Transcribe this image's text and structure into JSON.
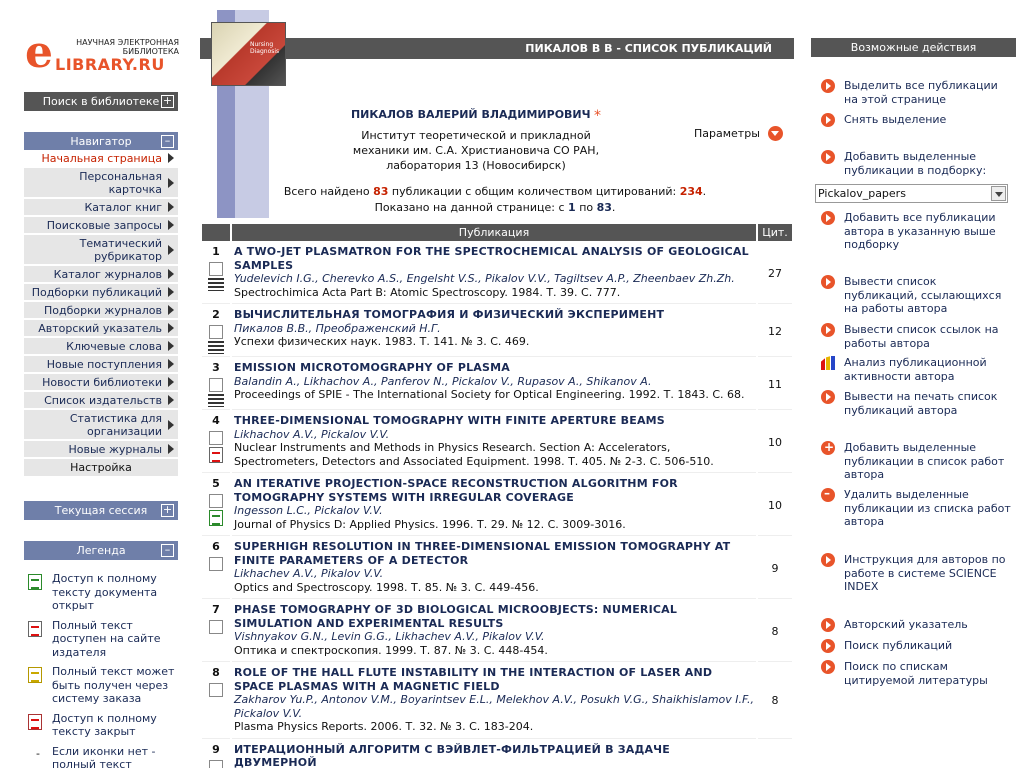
{
  "logo": {
    "top": "НАУЧНАЯ ЭЛЕКТРОННАЯ БИБЛИОТЕКА",
    "main": "LIBRARY.RU",
    "letter": "e"
  },
  "search": {
    "label": "Поиск в библиотеке",
    "toggle": "+"
  },
  "navigator": {
    "label": "Навигатор",
    "toggle": "–",
    "items": [
      "Начальная страница",
      "Персональная карточка",
      "Каталог книг",
      "Поисковые запросы",
      "Тематический рубрикатор",
      "Каталог журналов",
      "Подборки публикаций",
      "Подборки журналов",
      "Авторский указатель",
      "Ключевые слова",
      "Новые поступления",
      "Новости библиотеки",
      "Список издательств",
      "Статистика для организации",
      "Новые журналы",
      "Настройка"
    ]
  },
  "session": {
    "label": "Текущая сессия",
    "toggle": "+"
  },
  "legend": {
    "label": "Легенда",
    "toggle": "–",
    "items": [
      "Доступ к полному тексту документа открыт",
      "Полный текст доступен на сайте издателя",
      "Полный текст может быть получен через систему заказа",
      "Доступ к полному тексту закрыт",
      "Если иконки нет - полный текст"
    ],
    "last_prefix": "-"
  },
  "header": {
    "title": "ПИКАЛОВ В В - СПИСОК ПУБЛИКАЦИЙ"
  },
  "author": {
    "name": "ПИКАЛОВ ВАЛЕРИЙ ВЛАДИМИРОВИЧ",
    "star": "*",
    "institute": "Институт теоретической и прикладной механики им. С.А. Христиановича СО РАН,",
    "lab": "лаборатория 13 (Новосибирск)"
  },
  "params": {
    "label": "Параметры"
  },
  "stats": {
    "found_prefix": "Всего найдено",
    "found": "83",
    "found_mid": "публикации с общим количеством цитирований:",
    "citations": "234",
    "found_suffix": ".",
    "shown_prefix": "Показано на данной странице: с",
    "from": "1",
    "shown_mid": "по",
    "to": "83",
    "shown_suffix": "."
  },
  "table": {
    "col_pub": "Публикация",
    "col_cit": "Цит.",
    "rows": [
      {
        "n": "1",
        "title": "A TWO-JET PLASMATRON FOR THE SPECTROCHEMICAL ANALYSIS OF GEOLOGICAL SAMPLES",
        "authors": "Yudelevich I.G., Cherevko A.S., Engelsht V.S., Pikalov V.V., Tagiltsev A.P., Zheenbaev Zh.Zh.",
        "source": "Spectrochimica Acta Part B: Atomic Spectroscopy. 1984. Т. 39. С. 777.",
        "cit": "27",
        "icon": "refs"
      },
      {
        "n": "2",
        "title": "ВЫЧИСЛИТЕЛЬНАЯ ТОМОГРАФИЯ И ФИЗИЧЕСКИЙ ЭКСПЕРИМЕНТ",
        "authors": "Пикалов В.В., Преображенский Н.Г.",
        "source": "Успехи физических наук. 1983. Т. 141. № 3. С. 469.",
        "cit": "12",
        "icon": "refs"
      },
      {
        "n": "3",
        "title": "EMISSION MICROTOMOGRAPHY OF PLASMA",
        "authors": "Balandin A., Likhachov A., Panferov N., Pickalov V., Rupasov A., Shikanov A.",
        "source": "Proceedings of SPIE - The International Society for Optical Engineering. 1992. Т. 1843. С. 68.",
        "cit": "11",
        "icon": "refs"
      },
      {
        "n": "4",
        "title": "THREE-DIMENSIONAL TOMOGRAPHY WITH FINITE APERTURE BEAMS",
        "authors": "Likhachov A.V., Pickalov V.V.",
        "source": "Nuclear Instruments and Methods in Physics Research. Section A: Accelerators, Spectrometers, Detectors and Associated Equipment. 1998. Т. 405. № 2-3. С. 506-510.",
        "cit": "10",
        "icon": "pdf"
      },
      {
        "n": "5",
        "title": "AN ITERATIVE PROJECTION-SPACE RECONSTRUCTION ALGORITHM FOR TOMOGRAPHY SYSTEMS WITH IRREGULAR COVERAGE",
        "authors": "Ingesson L.C., Pickalov V.V.",
        "source": "Journal of Physics D: Applied Physics. 1996. Т. 29. № 12. С. 3009-3016.",
        "cit": "10",
        "icon": "pdf-green"
      },
      {
        "n": "6",
        "title": "SUPERHIGH RESOLUTION IN THREE-DIMENSIONAL EMISSION TOMOGRAPHY AT FINITE PARAMETERS OF A DETECTOR",
        "authors": "Likhachev A.V., Pikalov V.V.",
        "source": "Optics and Spectroscopy. 1998. Т. 85. № 3. С. 449-456.",
        "cit": "9",
        "icon": "none"
      },
      {
        "n": "7",
        "title": "PHASE TOMOGRAPHY OF 3D BIOLOGICAL MICROOBJECTS: NUMERICAL SIMULATION AND EXPERIMENTAL RESULTS",
        "authors": "Vishnyakov G.N., Levin G.G., Likhachev A.V., Pikalov V.V.",
        "source": "Оптика и спектроскопия. 1999. Т. 87. № 3. С. 448-454.",
        "cit": "8",
        "icon": "none"
      },
      {
        "n": "8",
        "title": "ROLE OF THE HALL FLUTE INSTABILITY IN THE INTERACTION OF LASER AND SPACE PLASMAS WITH A MAGNETIC FIELD",
        "authors": "Zakharov Yu.P., Antonov V.M., Boyarintsev E.L., Melekhov A.V., Posukh V.G., Shaikhislamov I.F., Pickalov V.V.",
        "source": "Plasma Physics Reports. 2006. Т. 32. № 3. С. 183-204.",
        "cit": "8",
        "icon": "none"
      },
      {
        "n": "9",
        "title": "ИТЕРАЦИОННЫЙ АЛГОРИТМ С ВЭЙВЛЕТ-ФИЛЬТРАЦИЕЙ В ЗАДАЧЕ ДВУМЕРНОЙ",
        "authors": "",
        "source": "",
        "cit": "",
        "icon": "none"
      }
    ]
  },
  "actions": {
    "label": "Возможные действия",
    "select_all": "Выделить все публикации на этой странице",
    "deselect": "Снять выделение",
    "add_selected": "Добавить выделенные публикации в подборку:",
    "collection": "Pickalov_papers",
    "add_all": "Добавить все публикации автора в указанную выше подборку",
    "citing": "Вывести список публикаций, ссылающихся на работы автора",
    "refs": "Вывести список ссылок на работы автора",
    "analysis": "Анализ публикационной активности автора",
    "print": "Вывести на печать список публикаций автора",
    "add_to_list": "Добавить выделенные публикации в список работ автора",
    "remove_from_list": "Удалить выделенные публикации из списка работ автора",
    "instructions": "Инструкция для авторов по работе в системе SCIENCE INDEX",
    "author_index": "Авторский указатель",
    "search_pubs": "Поиск публикаций",
    "search_refs": "Поиск по спискам цитируемой литературы"
  }
}
